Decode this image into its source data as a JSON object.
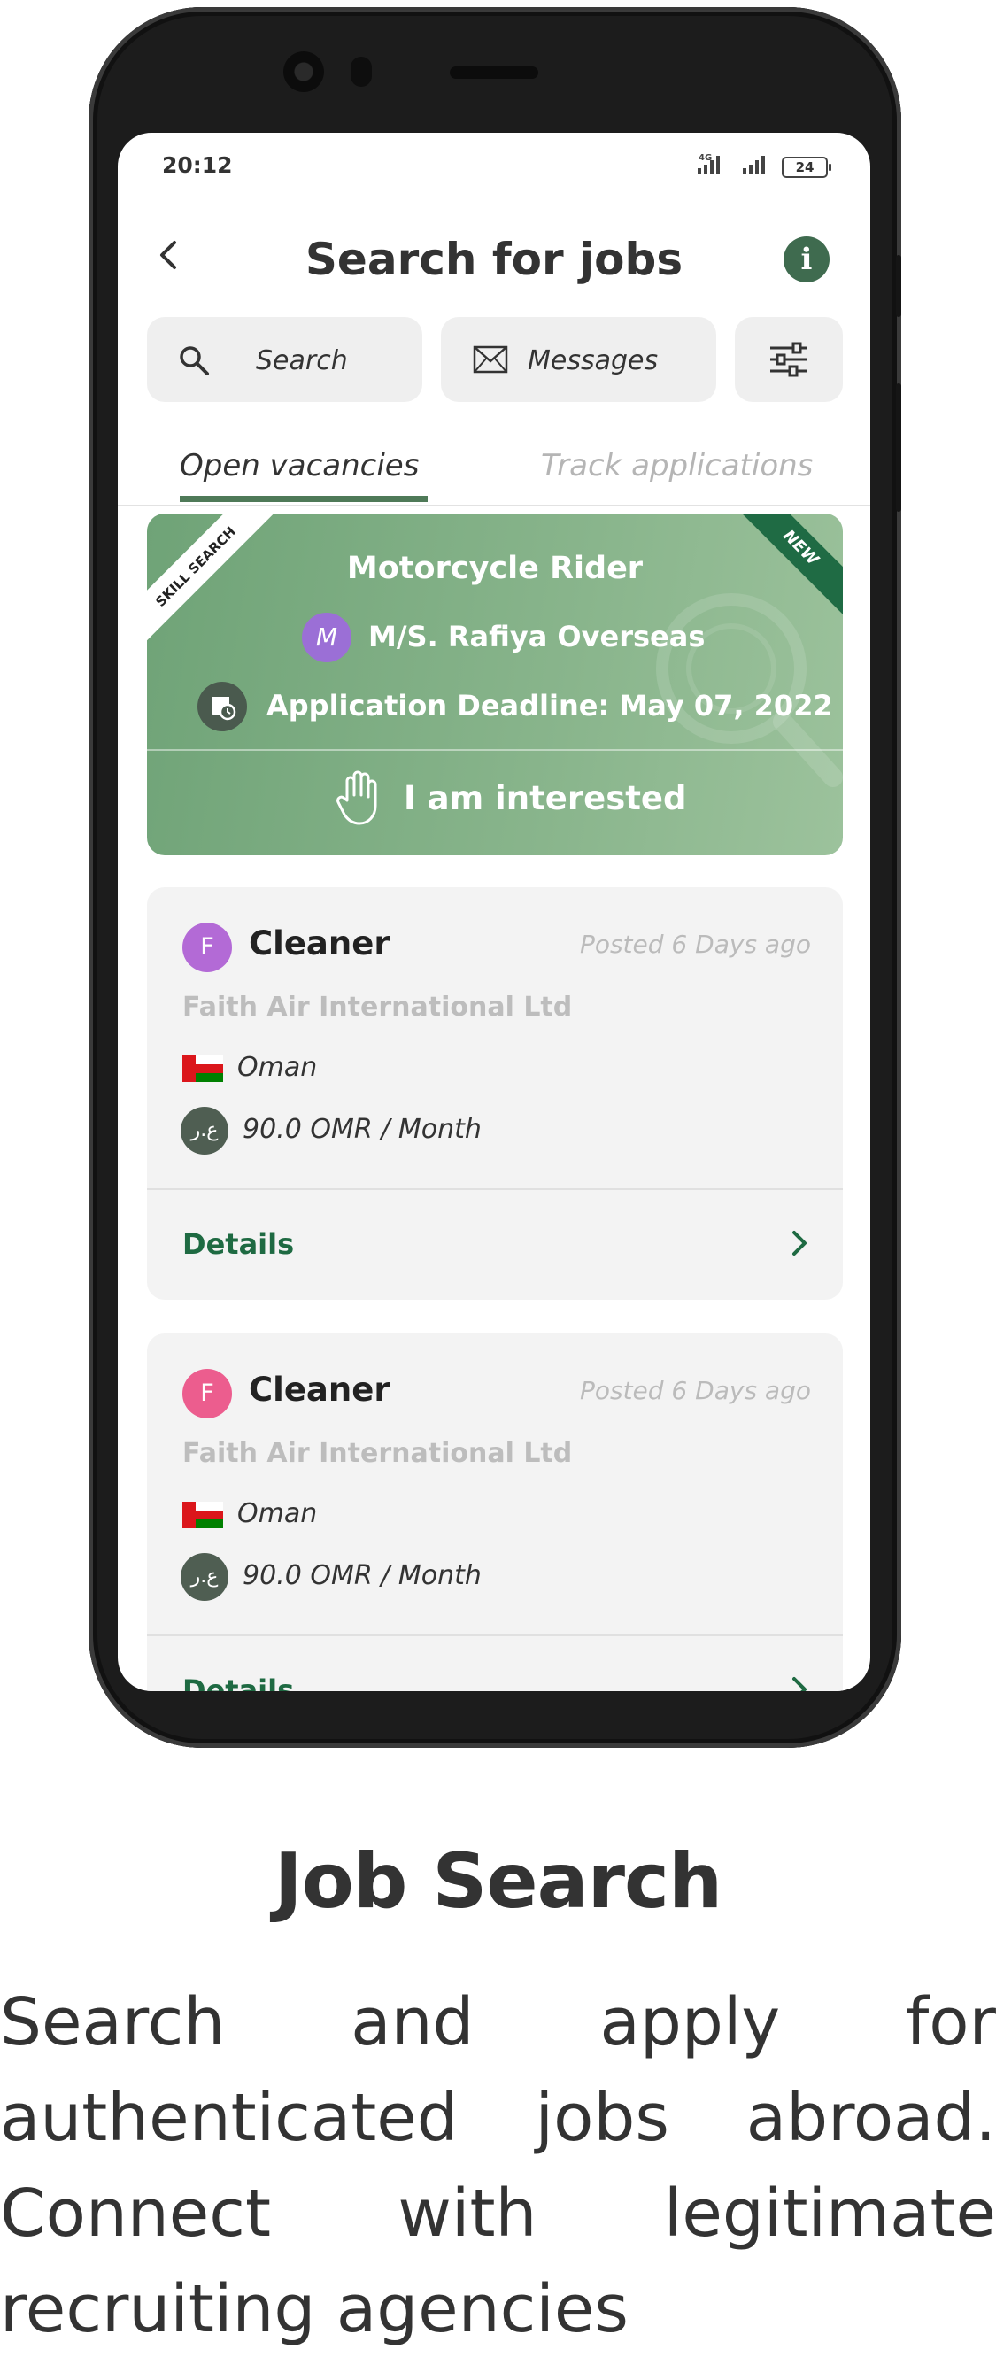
{
  "status_bar": {
    "time": "20:12",
    "network_label": "4G",
    "battery": "24"
  },
  "header": {
    "title": "Search for jobs"
  },
  "toolbar": {
    "search_label": "Search",
    "messages_label": "Messages"
  },
  "tabs": [
    {
      "label": "Open vacancies",
      "active": true
    },
    {
      "label": "Track applications",
      "active": false
    }
  ],
  "featured": {
    "ribbon_left": "SKILL SEARCH",
    "ribbon_right": "NEW",
    "title": "Motorcycle Rider",
    "avatar_letter": "M",
    "company": "M/S. Rafiya Overseas",
    "deadline": "Application Deadline: May 07, 2022",
    "action_label": "I am interested",
    "background_color": "#7fae84"
  },
  "jobs": [
    {
      "avatar_letter": "F",
      "avatar_color": "#b36ad6",
      "title": "Cleaner",
      "posted": "Posted 6 Days  ago",
      "company": "Faith Air International Ltd",
      "country": "Oman",
      "currency_icon": "ع.ر",
      "salary": "90.0 OMR / Month",
      "details_label": "Details"
    },
    {
      "avatar_letter": "F",
      "avatar_color": "#ec5d8e",
      "title": "Cleaner",
      "posted": "Posted 6 Days  ago",
      "company": "Faith Air International Ltd",
      "country": "Oman",
      "currency_icon": "ع.ر",
      "salary": "90.0 OMR / Month",
      "details_label": "Details"
    }
  ],
  "caption": {
    "title": "Job Search",
    "lines": [
      [
        "Search",
        "and",
        "apply",
        "for"
      ],
      [
        "authenticated",
        "jobs",
        "abroad."
      ],
      [
        "Connect",
        "with",
        "legitimate"
      ],
      [
        "recruiting agencies"
      ]
    ]
  },
  "colors": {
    "accent": "#1e6a42",
    "tab_underline": "#4f7a58",
    "info_button": "#3f6b4f"
  }
}
